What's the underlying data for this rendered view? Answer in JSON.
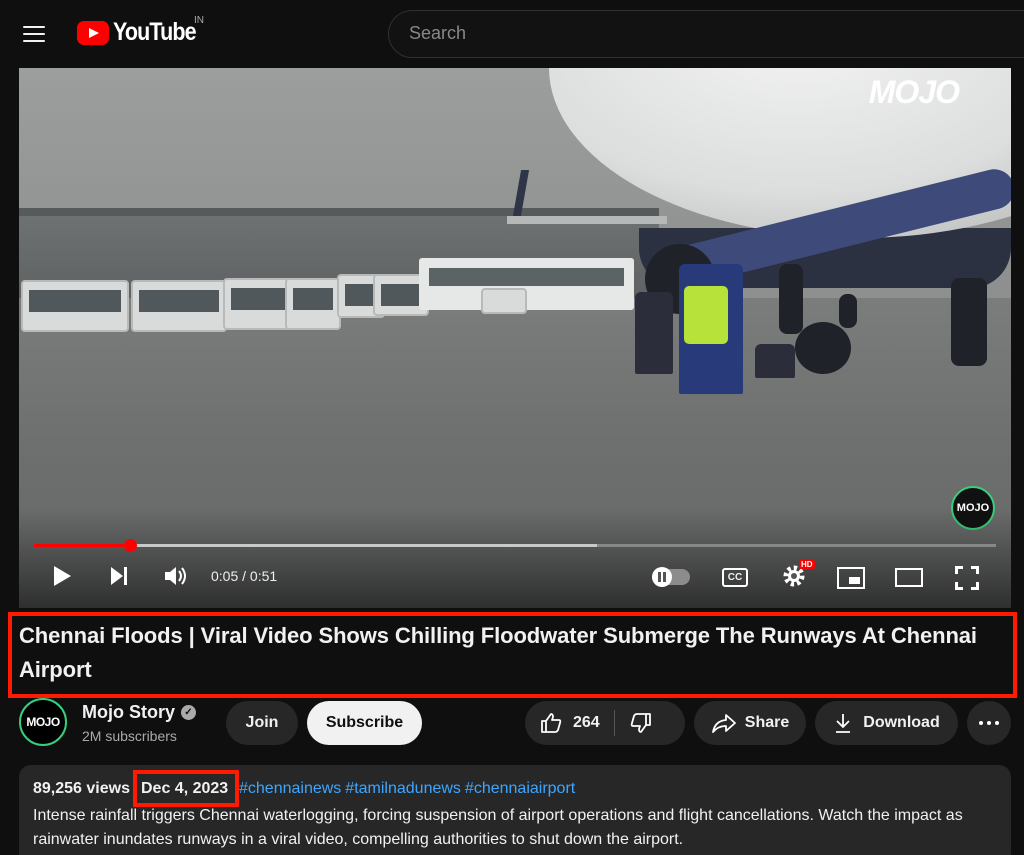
{
  "header": {
    "logo_text": "YouTube",
    "country_code": "IN",
    "search_placeholder": "Search"
  },
  "player": {
    "watermark": "MOJO",
    "corner_logo": "MOJO",
    "time_display": "0:05 / 0:51",
    "progress_fraction": 0.1,
    "buffered_fraction": 0.585,
    "hd_badge": "HD",
    "cc_label": "CC"
  },
  "video": {
    "title": "Chennai Floods | Viral Video Shows Chilling Floodwater Submerge The Runways At Chennai Airport"
  },
  "channel": {
    "avatar_text": "MOJO",
    "name": "Mojo Story",
    "subscribers": "2M subscribers",
    "join_label": "Join",
    "subscribe_label": "Subscribe"
  },
  "actions": {
    "like_count": "264",
    "share_label": "Share",
    "download_label": "Download"
  },
  "description": {
    "views": "89,256 views",
    "date": "Dec 4, 2023",
    "tags": [
      "#chennainews",
      "#tamilnadunews",
      "#chennaiairport"
    ],
    "text": "Intense rainfall triggers Chennai waterlogging, forcing suspension of airport operations and flight cancellations. Watch the impact as rainwater inundates runways in a viral video, compelling authorities to shut down the airport."
  },
  "colors": {
    "accent_red": "#ff0000",
    "annotation_red": "#ff1a00",
    "link_blue": "#3ea6ff",
    "background": "#0f0f0f",
    "pill_bg": "#272727"
  }
}
